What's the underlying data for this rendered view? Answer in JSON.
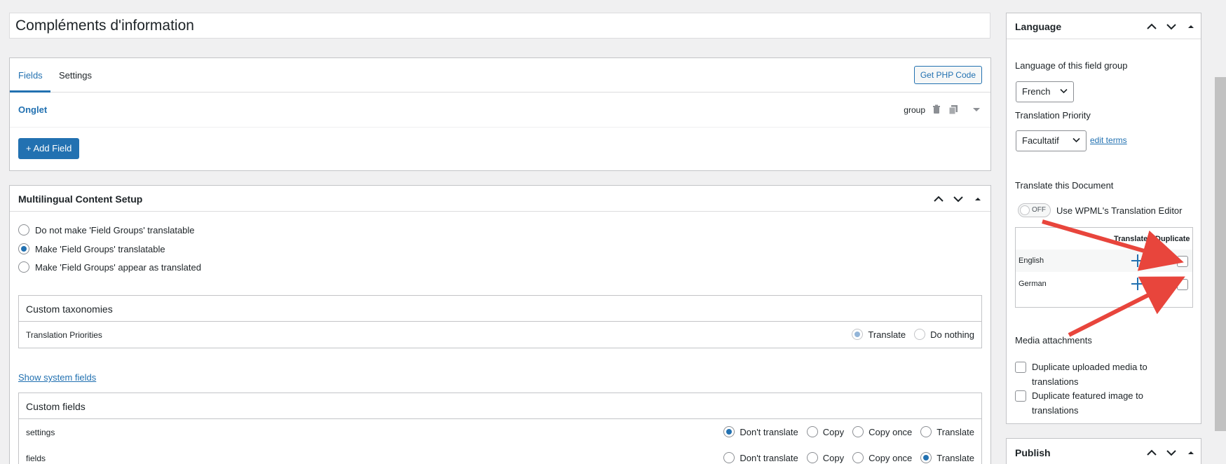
{
  "title_field": {
    "value": "Compléments d'information"
  },
  "fields_box": {
    "tabs": [
      {
        "label": "Fields"
      },
      {
        "label": "Settings"
      }
    ],
    "get_php_code": "Get PHP Code",
    "field": {
      "label": "Onglet",
      "type": "group"
    },
    "add_field": "+ Add Field"
  },
  "multilingual": {
    "title": "Multilingual Content Setup",
    "options": [
      {
        "label": "Do not make 'Field Groups' translatable",
        "selected": false
      },
      {
        "label": "Make 'Field Groups' translatable",
        "selected": true
      },
      {
        "label": "Make 'Field Groups' appear as translated",
        "selected": false
      }
    ],
    "taxonomies": {
      "header": "Custom taxonomies",
      "rows": [
        {
          "label": "Translation Priorities",
          "options": [
            "Translate",
            "Do nothing"
          ],
          "selected": "Translate"
        }
      ]
    },
    "show_system_fields": "Show system fields",
    "custom_fields": {
      "header": "Custom fields",
      "options": [
        "Don't translate",
        "Copy",
        "Copy once",
        "Translate"
      ],
      "rows": [
        {
          "label": "settings",
          "selected": "Don't translate"
        },
        {
          "label": "fields",
          "selected": "Translate"
        }
      ]
    }
  },
  "language_box": {
    "title": "Language",
    "lang_label": "Language of this field group",
    "lang_value": "French",
    "priority_label": "Translation Priority",
    "priority_value": "Facultatif",
    "edit_terms": "edit terms",
    "translate_doc_label": "Translate this Document",
    "toggle_state": "OFF",
    "toggle_label": "Use WPML's Translation Editor",
    "table": {
      "col_translate": "Translate",
      "col_duplicate": "Duplicate",
      "rows": [
        {
          "lang": "English"
        },
        {
          "lang": "German"
        }
      ]
    },
    "media_label": "Media attachments",
    "media_options": [
      {
        "label": "Duplicate uploaded media to translations",
        "checked": false
      },
      {
        "label": "Duplicate featured image to translations",
        "checked": false
      }
    ]
  },
  "publish_box": {
    "title": "Publish"
  },
  "colors": {
    "accent": "#2271b1",
    "arrow": "#e8453c",
    "border": "#c3c4c7",
    "page_bg": "#f0f0f1"
  }
}
